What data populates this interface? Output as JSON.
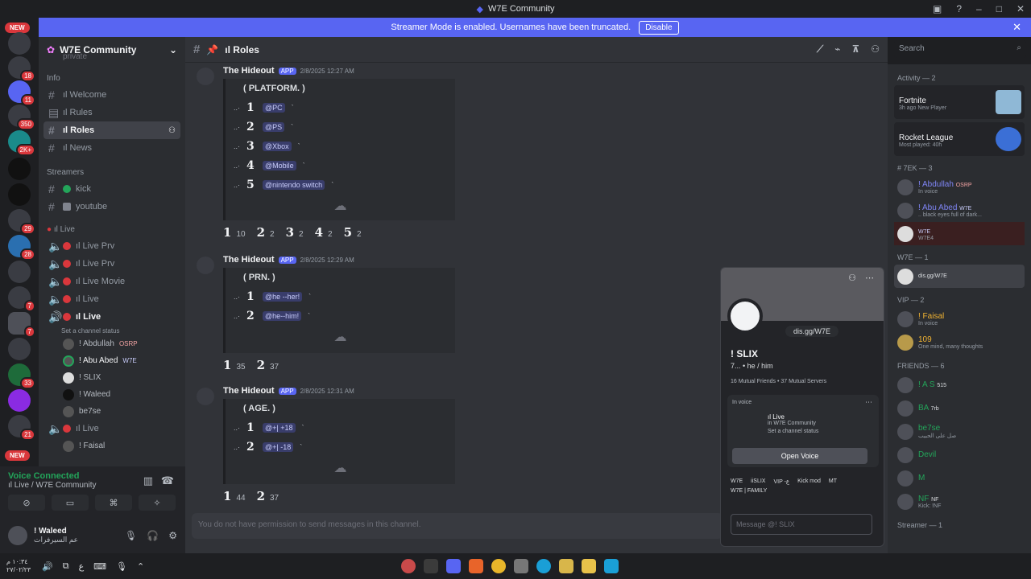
{
  "window": {
    "title": "W7E Community"
  },
  "banner": {
    "text": "Streamer Mode is enabled. Usernames have been truncated.",
    "button": "Disable"
  },
  "server_rail": {
    "new_top": "NEW",
    "new_bottom": "NEW",
    "badges": [
      "18",
      "11",
      "350",
      "2K+",
      "29",
      "28",
      "7",
      "7",
      "33",
      "21"
    ]
  },
  "guild": {
    "name": "W7E Community",
    "private_item": "private"
  },
  "channels": {
    "info_label": "Info",
    "info": [
      {
        "label": "ıl Welcome"
      },
      {
        "label": "ıl Rules"
      },
      {
        "label": "ıl Roles"
      },
      {
        "label": "ıl News"
      }
    ],
    "streamers_label": "Streamers",
    "streamers": [
      {
        "label": "kick"
      },
      {
        "label": "youtube"
      }
    ],
    "live_label": "ıl Live",
    "voice": [
      {
        "label": "ıl Live Prv"
      },
      {
        "label": "ıl Live Prv"
      },
      {
        "label": "ıl Live Movie"
      },
      {
        "label": "ıl Live"
      },
      {
        "label": "ıl Live"
      }
    ],
    "status_hint": "Set a channel status",
    "voice_users": [
      {
        "name": "! Abdullah",
        "tag": "OSRP"
      },
      {
        "name": "! Abu Abed",
        "tag": "W7E"
      },
      {
        "name": "! SLIX",
        "tag": ""
      },
      {
        "name": "! Waleed",
        "tag": ""
      },
      {
        "name": "be7se",
        "tag": ""
      }
    ],
    "voice_after": {
      "label": "ıl Live"
    },
    "voice_user_last": "! Faisal"
  },
  "voice_status": {
    "connected": "Voice Connected",
    "location": "ıl Live / W7E Community"
  },
  "user": {
    "name": "! Waleed",
    "status": "عم السيرفرات"
  },
  "chan_header": {
    "name": "ıl Roles",
    "search": "Search"
  },
  "messages": [
    {
      "author": "The Hideout",
      "app": "APP",
      "time": "2/8/2025 12:27 AM",
      "title": "(   PLATFORM.  )",
      "rows": [
        {
          "num": "1",
          "role": "@PC"
        },
        {
          "num": "2",
          "role": "@PS"
        },
        {
          "num": "3",
          "role": "@Xbox"
        },
        {
          "num": "4",
          "role": "@Mobile"
        },
        {
          "num": "5",
          "role": "@nintendo switch"
        }
      ],
      "reactions": [
        {
          "emoji": "1",
          "count": "10"
        },
        {
          "emoji": "2",
          "count": "2"
        },
        {
          "emoji": "3",
          "count": "2"
        },
        {
          "emoji": "4",
          "count": "2"
        },
        {
          "emoji": "5",
          "count": "2"
        }
      ]
    },
    {
      "author": "The Hideout",
      "app": "APP",
      "time": "2/8/2025 12:29 AM",
      "title": "(   PRN.  )",
      "rows": [
        {
          "num": "1",
          "role": "@he --her!"
        },
        {
          "num": "2",
          "role": "@he--him!"
        }
      ],
      "reactions": [
        {
          "emoji": "1",
          "count": "35"
        },
        {
          "emoji": "2",
          "count": "37"
        }
      ]
    },
    {
      "author": "The Hideout",
      "app": "APP",
      "time": "2/8/2025 12:31 AM",
      "title": "(   AGE.  )",
      "rows": [
        {
          "num": "1",
          "role": "@+| +18"
        },
        {
          "num": "2",
          "role": "@+| -18"
        }
      ],
      "reactions": [
        {
          "emoji": "1",
          "count": "44"
        },
        {
          "emoji": "2",
          "count": "37"
        }
      ]
    }
  ],
  "composer": {
    "placeholder": "You do not have permission to send messages in this channel."
  },
  "members": {
    "activity_label": "Activity — 2",
    "activities": [
      {
        "title": "Fortnite",
        "sub": "3h ago  New Player"
      },
      {
        "title": "Rocket League",
        "sub": "Most played: 40h"
      }
    ],
    "groups": [
      {
        "label": "# 7EK — 3",
        "items": [
          {
            "name": "! Abdullah",
            "sub": "In voice",
            "tag": "OSRP"
          },
          {
            "name": "! Abu Abed",
            "sub": ".. black eyes full of dark...",
            "tag": "W7E"
          },
          {
            "name": "",
            "sub": "W7E4",
            "tag": "W7E"
          }
        ]
      },
      {
        "label": "W7E — 1",
        "items": [
          {
            "name": "",
            "sub": "dis.gg/W7E",
            "tag": ""
          }
        ]
      },
      {
        "label": "VIP — 2",
        "items": [
          {
            "name": "! Faisal",
            "sub": "In voice",
            "tag": ""
          },
          {
            "name": "109",
            "sub": "One mind, many thoughts",
            "tag": ""
          }
        ]
      },
      {
        "label": "FRIENDS — 6",
        "items": [
          {
            "name": "! A S",
            "sub": "",
            "tag": "515"
          },
          {
            "name": "BA",
            "sub": "",
            "tag": "7rb"
          },
          {
            "name": "be7se",
            "sub": "صل على الحبيب",
            "tag": ""
          },
          {
            "name": "Devil",
            "sub": "",
            "tag": ""
          },
          {
            "name": "M",
            "sub": "",
            "tag": ""
          },
          {
            "name": "NF",
            "sub": "Kick: !NF",
            "tag": "NF"
          }
        ]
      },
      {
        "label": "Streamer — 1",
        "items": []
      }
    ]
  },
  "popout": {
    "link": "dis.gg/W7E",
    "name": "! SLIX",
    "pronouns": "7...  •  he / him",
    "mutual": "16 Mutual Friends  •  37 Mutual Servers",
    "in_voice": "In voice",
    "channel": "ıl Live",
    "server": "in W7E Community",
    "status_hint": "Set a channel status",
    "open_voice": "Open Voice",
    "roles": [
      "W7E",
      "iiSLIX",
      "VIP -ع",
      "Kick mod",
      "MT",
      "W7E | FAMILY"
    ],
    "message_placeholder": "Message @! SLIX"
  },
  "taskbar": {
    "time": "١٠:٣٤ م",
    "date": "٢٧/٠٢/٢٣"
  }
}
